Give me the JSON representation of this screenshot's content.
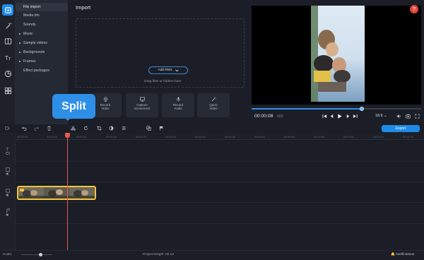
{
  "sidebar_menu": {
    "items": [
      {
        "label": "File import",
        "active": true,
        "dot": false
      },
      {
        "label": "Media bin",
        "active": false,
        "dot": false
      },
      {
        "label": "Sounds",
        "active": false,
        "dot": false
      },
      {
        "label": "Music",
        "active": false,
        "dot": true
      },
      {
        "label": "Sample videos",
        "active": false,
        "dot": true
      },
      {
        "label": "Backgrounds",
        "active": false,
        "dot": true
      },
      {
        "label": "Frames",
        "active": false,
        "dot": true
      },
      {
        "label": "Effect packages",
        "active": false,
        "dot": false
      }
    ]
  },
  "import_panel": {
    "title": "Import",
    "add_files_label": "Add Files",
    "drop_hint": "Drag files or folders here"
  },
  "record_buttons": [
    {
      "label": "Record\nVideo",
      "icon": "webcam-icon"
    },
    {
      "label": "Capture\nScreencast",
      "icon": "monitor-icon"
    },
    {
      "label": "Record\nAudio",
      "icon": "microphone-icon"
    },
    {
      "label": "Quick\nVideo",
      "icon": "magic-wand-icon"
    }
  ],
  "tooltip": {
    "text": "Split"
  },
  "player": {
    "time": "00:00:08",
    "time_frac": "000",
    "aspect_ratio": "16:9",
    "progress_fraction": 0.65
  },
  "export_label": "Export",
  "ruler_ticks": [
    "00:00:00",
    "00:00:05",
    "00:00:10",
    "00:00:15",
    "00:00:20",
    "00:00:25",
    "00:00:30",
    "00:00:35",
    "00:00:40",
    "00:00:45",
    "00:00:50",
    "00:00:55",
    "00:01:00",
    "00:01:05"
  ],
  "statusbar": {
    "scale_label": "Scale:",
    "project_length": "Project length:  00:13",
    "notifications": "Notifications"
  },
  "colors": {
    "accent": "#1f8be6",
    "clip_border": "#f2c53b",
    "playhead": "#e85a50",
    "help": "#e2473a"
  }
}
